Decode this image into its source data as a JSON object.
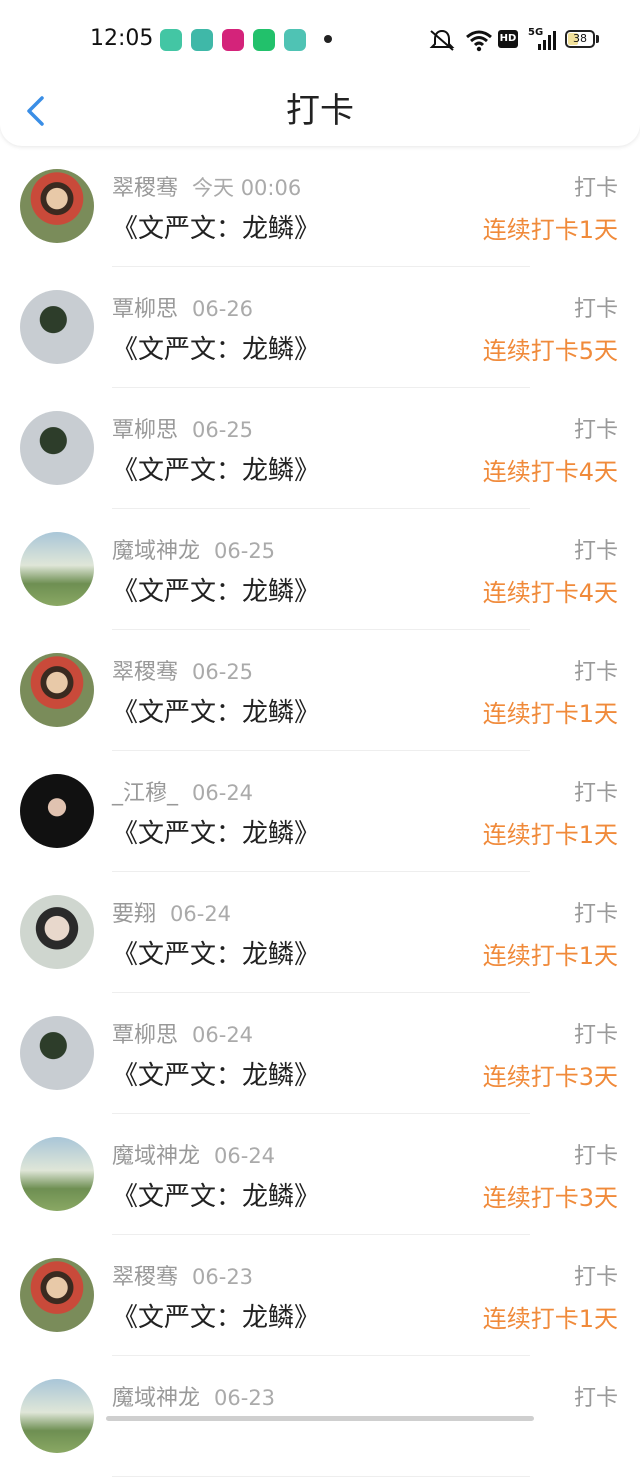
{
  "status_bar": {
    "time": "12:05",
    "battery": "38",
    "network": "5G",
    "hd_label": "HD"
  },
  "header": {
    "title": "打卡",
    "back_icon": "chevron-left-icon"
  },
  "colors": {
    "accent_blue": "#3a8ee6",
    "streak_orange": "#f08a3a",
    "text_gray": "#999999"
  },
  "items": [
    {
      "user": "翠稷骞",
      "date": "今天 00:06",
      "title": "《文严文：龙鳞》",
      "tag": "打卡",
      "streak": "连续打卡1天"
    },
    {
      "user": "覃柳思",
      "date": "06-26",
      "title": "《文严文：龙鳞》",
      "tag": "打卡",
      "streak": "连续打卡5天"
    },
    {
      "user": "覃柳思",
      "date": "06-25",
      "title": "《文严文：龙鳞》",
      "tag": "打卡",
      "streak": "连续打卡4天"
    },
    {
      "user": "魔域神龙",
      "date": "06-25",
      "title": "《文严文：龙鳞》",
      "tag": "打卡",
      "streak": "连续打卡4天"
    },
    {
      "user": "翠稷骞",
      "date": "06-25",
      "title": "《文严文：龙鳞》",
      "tag": "打卡",
      "streak": "连续打卡1天"
    },
    {
      "user": "_江穆_",
      "date": "06-24",
      "title": "《文严文：龙鳞》",
      "tag": "打卡",
      "streak": "连续打卡1天"
    },
    {
      "user": "要翔",
      "date": "06-24",
      "title": "《文严文：龙鳞》",
      "tag": "打卡",
      "streak": "连续打卡1天"
    },
    {
      "user": "覃柳思",
      "date": "06-24",
      "title": "《文严文：龙鳞》",
      "tag": "打卡",
      "streak": "连续打卡3天"
    },
    {
      "user": "魔域神龙",
      "date": "06-24",
      "title": "《文严文：龙鳞》",
      "tag": "打卡",
      "streak": "连续打卡3天"
    },
    {
      "user": "翠稷骞",
      "date": "06-23",
      "title": "《文严文：龙鳞》",
      "tag": "打卡",
      "streak": "连续打卡1天"
    },
    {
      "user": "魔域神龙",
      "date": "06-23",
      "title": "",
      "tag": "打卡",
      "streak": ""
    }
  ]
}
